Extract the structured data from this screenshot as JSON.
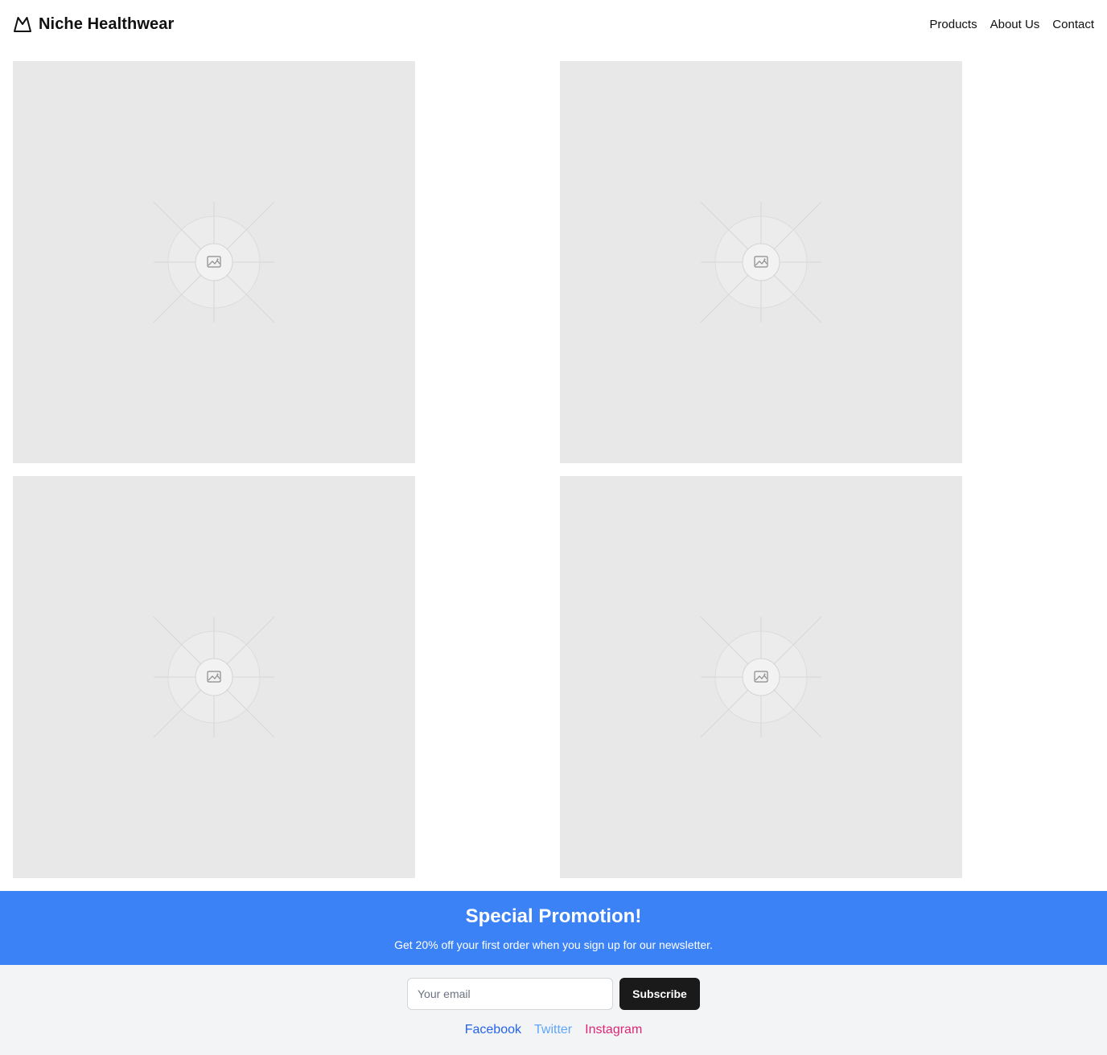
{
  "header": {
    "brand_name": "Niche Healthwear",
    "brand_icon": "mountain-icon",
    "nav": {
      "products": "Products",
      "about": "About Us",
      "contact": "Contact"
    }
  },
  "products": {
    "tiles": [
      {
        "icon": "image-placeholder-icon"
      },
      {
        "icon": "image-placeholder-icon"
      },
      {
        "icon": "image-placeholder-icon"
      },
      {
        "icon": "image-placeholder-icon"
      }
    ]
  },
  "promo": {
    "title": "Special Promotion!",
    "text": "Get 20% off your first order when you sign up for our newsletter.",
    "background": "#3b82f6"
  },
  "newsletter": {
    "email_placeholder": "Your email",
    "email_value": "",
    "subscribe_label": "Subscribe"
  },
  "social": {
    "facebook": {
      "label": "Facebook",
      "color": "#2563eb"
    },
    "twitter": {
      "label": "Twitter",
      "color": "#60a5fa"
    },
    "instagram": {
      "label": "Instagram",
      "color": "#db2777"
    }
  }
}
